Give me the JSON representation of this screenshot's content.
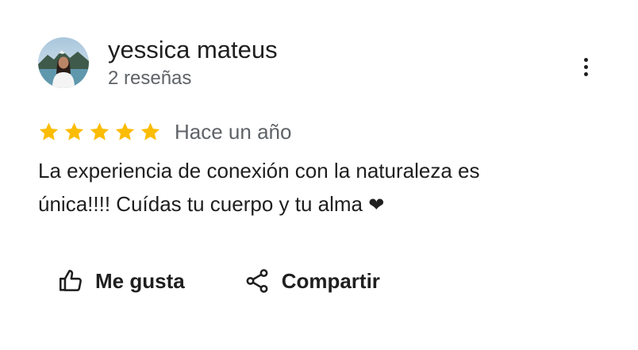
{
  "reviewer": {
    "name": "yessica mateus",
    "review_count": "2 reseñas",
    "avatar_icon": "profile-photo"
  },
  "more_icon": "more-vertical-icon",
  "rating": {
    "stars": 5,
    "max_stars": 5,
    "star_color": "#fbbc04",
    "date": "Hace un año"
  },
  "review": {
    "line1": "La experiencia de conexión con la naturaleza es",
    "line2": "única!!!!  Cuídas tu cuerpo y tu alma",
    "emoji": "❤"
  },
  "actions": {
    "like_label": "Me gusta",
    "like_icon": "thumb-up-icon",
    "share_label": "Compartir",
    "share_icon": "share-icon"
  }
}
